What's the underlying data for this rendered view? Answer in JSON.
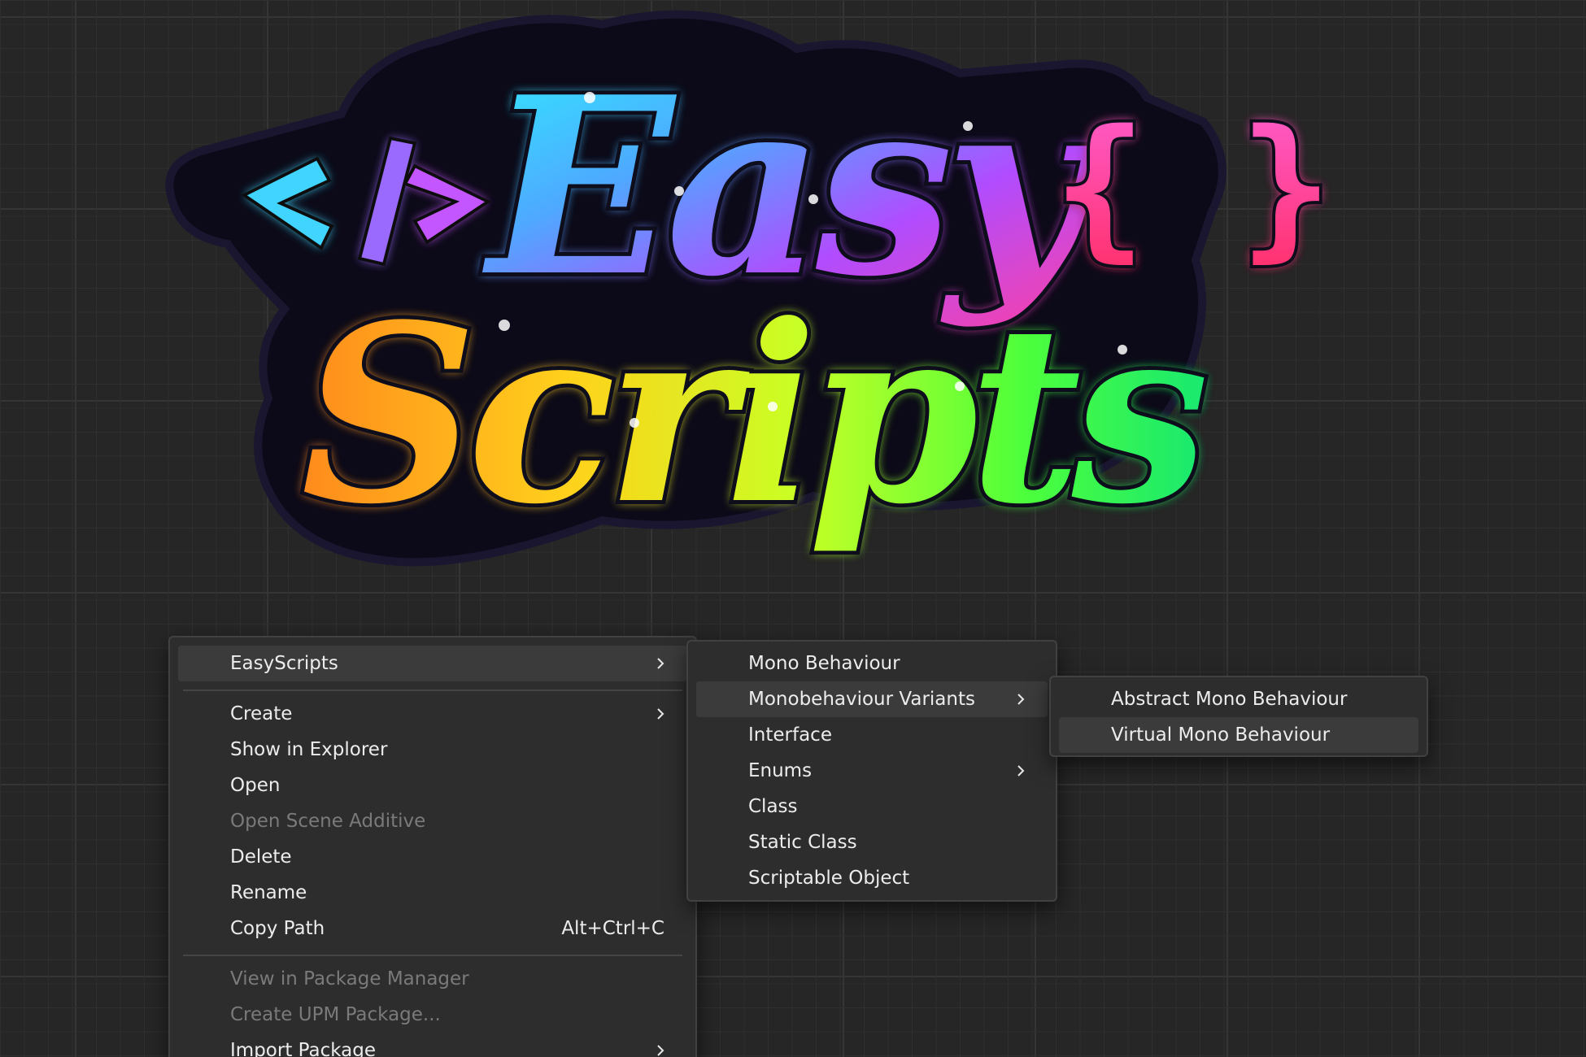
{
  "logo": {
    "text_line1": "Easy",
    "text_line2": "Scripts",
    "code_tag": "</>",
    "braces": "{ }"
  },
  "menu_main": {
    "items": [
      {
        "label": "EasyScripts",
        "has_submenu": true,
        "highlighted": true
      },
      {
        "label": "Create",
        "has_submenu": true
      },
      {
        "label": "Show in Explorer"
      },
      {
        "label": "Open"
      },
      {
        "label": "Open Scene Additive",
        "disabled": true
      },
      {
        "label": "Delete"
      },
      {
        "label": "Rename"
      },
      {
        "label": "Copy Path",
        "shortcut": "Alt+Ctrl+C"
      },
      {
        "label": "View in Package Manager",
        "disabled": true
      },
      {
        "label": "Create UPM Package...",
        "disabled": true
      },
      {
        "label": "Import Package",
        "has_submenu": true
      }
    ]
  },
  "menu_easyscripts": {
    "items": [
      {
        "label": "Mono Behaviour"
      },
      {
        "label": "Monobehaviour Variants",
        "has_submenu": true,
        "highlighted": true
      },
      {
        "label": "Interface"
      },
      {
        "label": "Enums",
        "has_submenu": true
      },
      {
        "label": "Class"
      },
      {
        "label": "Static Class"
      },
      {
        "label": "Scriptable Object"
      }
    ]
  },
  "menu_variants": {
    "items": [
      {
        "label": "Abstract Mono Behaviour"
      },
      {
        "label": "Virtual Mono Behaviour",
        "highlighted": true
      }
    ]
  },
  "colors": {
    "background": "#262626",
    "menu_bg": "#2d2d2d",
    "menu_highlight": "#3b3b3b",
    "text": "#ececec",
    "text_disabled": "#7a7a7a"
  }
}
